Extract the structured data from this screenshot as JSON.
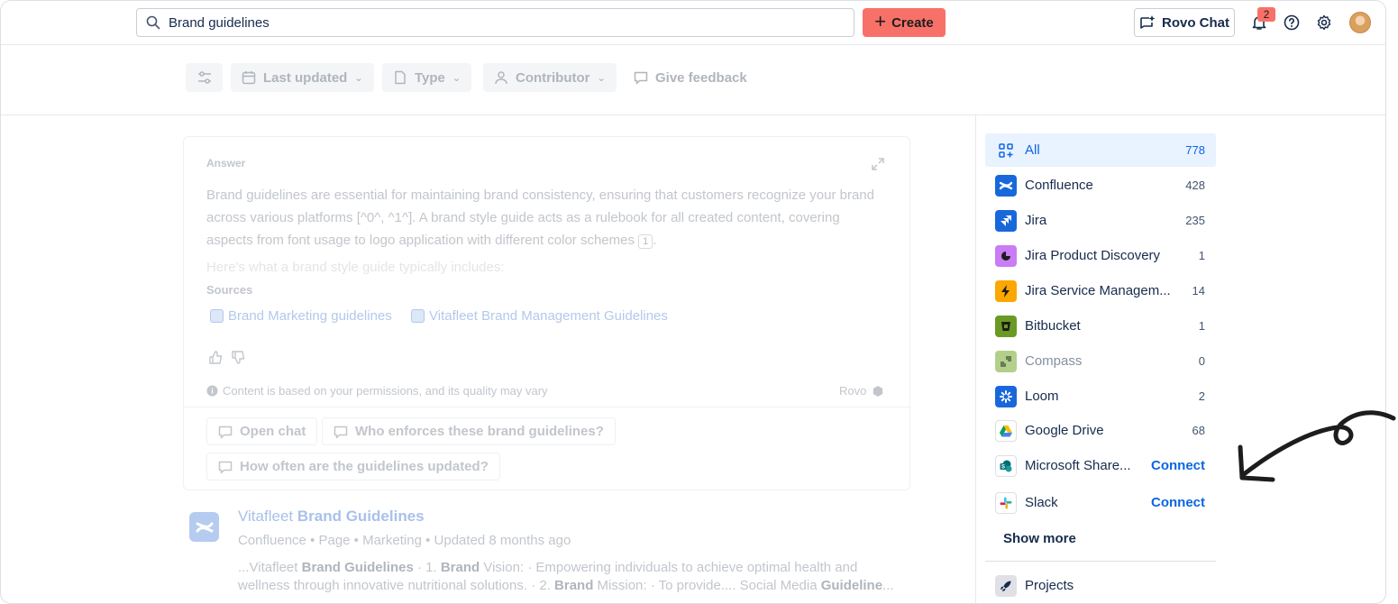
{
  "header": {
    "search_value": "Brand guidelines",
    "create_label": "Create",
    "rovo_chat_label": "Rovo Chat",
    "notification_count": "2"
  },
  "filters": {
    "last_updated": "Last updated",
    "type": "Type",
    "contributor": "Contributor",
    "give_feedback": "Give feedback"
  },
  "answer": {
    "label": "Answer",
    "text": "Brand guidelines are essential for maintaining brand consistency, ensuring that customers recognize your brand across various platforms [^0^, ^1^]. A brand style guide acts as a rulebook for all created content, covering aspects from font usage to logo application with different color schemes",
    "ref": "1",
    "faded_line": "Here's what a brand style guide typically includes:",
    "sources_label": "Sources",
    "sources": [
      "Brand Marketing guidelines",
      "Vitafleet Brand Management Guidelines"
    ],
    "disclaimer": "Content is based on your permissions, and its quality may vary",
    "rovo_label": "Rovo",
    "suggestions": [
      "Open chat",
      "Who enforces these brand guidelines?",
      "How often are the guidelines updated?"
    ]
  },
  "result": {
    "title_prefix": "Vitafleet",
    "title_bold": "Brand Guidelines",
    "meta": "Confluence • Page • Marketing • Updated 8 months ago",
    "snippet_line1_parts": [
      "...Vitafleet ",
      "Brand Guidelines",
      " · 1. ",
      "Brand",
      " Vision: · Empowering individuals to achieve optimal health and"
    ],
    "snippet_line2_parts": [
      "wellness through innovative nutritional solutions. · 2. ",
      "Brand",
      " Mission: · To provide.... Social Media ",
      "Guideline",
      "..."
    ]
  },
  "sidebar": {
    "items": [
      {
        "label": "All",
        "count": "778",
        "icon": "grid-icon"
      },
      {
        "label": "Confluence",
        "count": "428",
        "icon": "confluence-icon",
        "color": "#1868db"
      },
      {
        "label": "Jira",
        "count": "235",
        "icon": "jira-icon",
        "color": "#1868db"
      },
      {
        "label": "Jira Product Discovery",
        "count": "1",
        "icon": "product-discovery-icon",
        "color": "#c97cf4"
      },
      {
        "label": "Jira Service Managem...",
        "count": "14",
        "icon": "service-management-icon",
        "color": "#fca700"
      },
      {
        "label": "Bitbucket",
        "count": "1",
        "icon": "bitbucket-icon",
        "color": "#6a9a23"
      },
      {
        "label": "Compass",
        "count": "0",
        "icon": "compass-icon",
        "color": "#b3d08a"
      },
      {
        "label": "Loom",
        "count": "2",
        "icon": "loom-icon",
        "color": "#1868db"
      },
      {
        "label": "Google Drive",
        "count": "68",
        "icon": "google-drive-icon"
      },
      {
        "label": "Microsoft Share...",
        "connect": "Connect",
        "icon": "sharepoint-icon"
      },
      {
        "label": "Slack",
        "connect": "Connect",
        "icon": "slack-icon"
      }
    ],
    "show_more": "Show more",
    "projects_label": "Projects"
  }
}
